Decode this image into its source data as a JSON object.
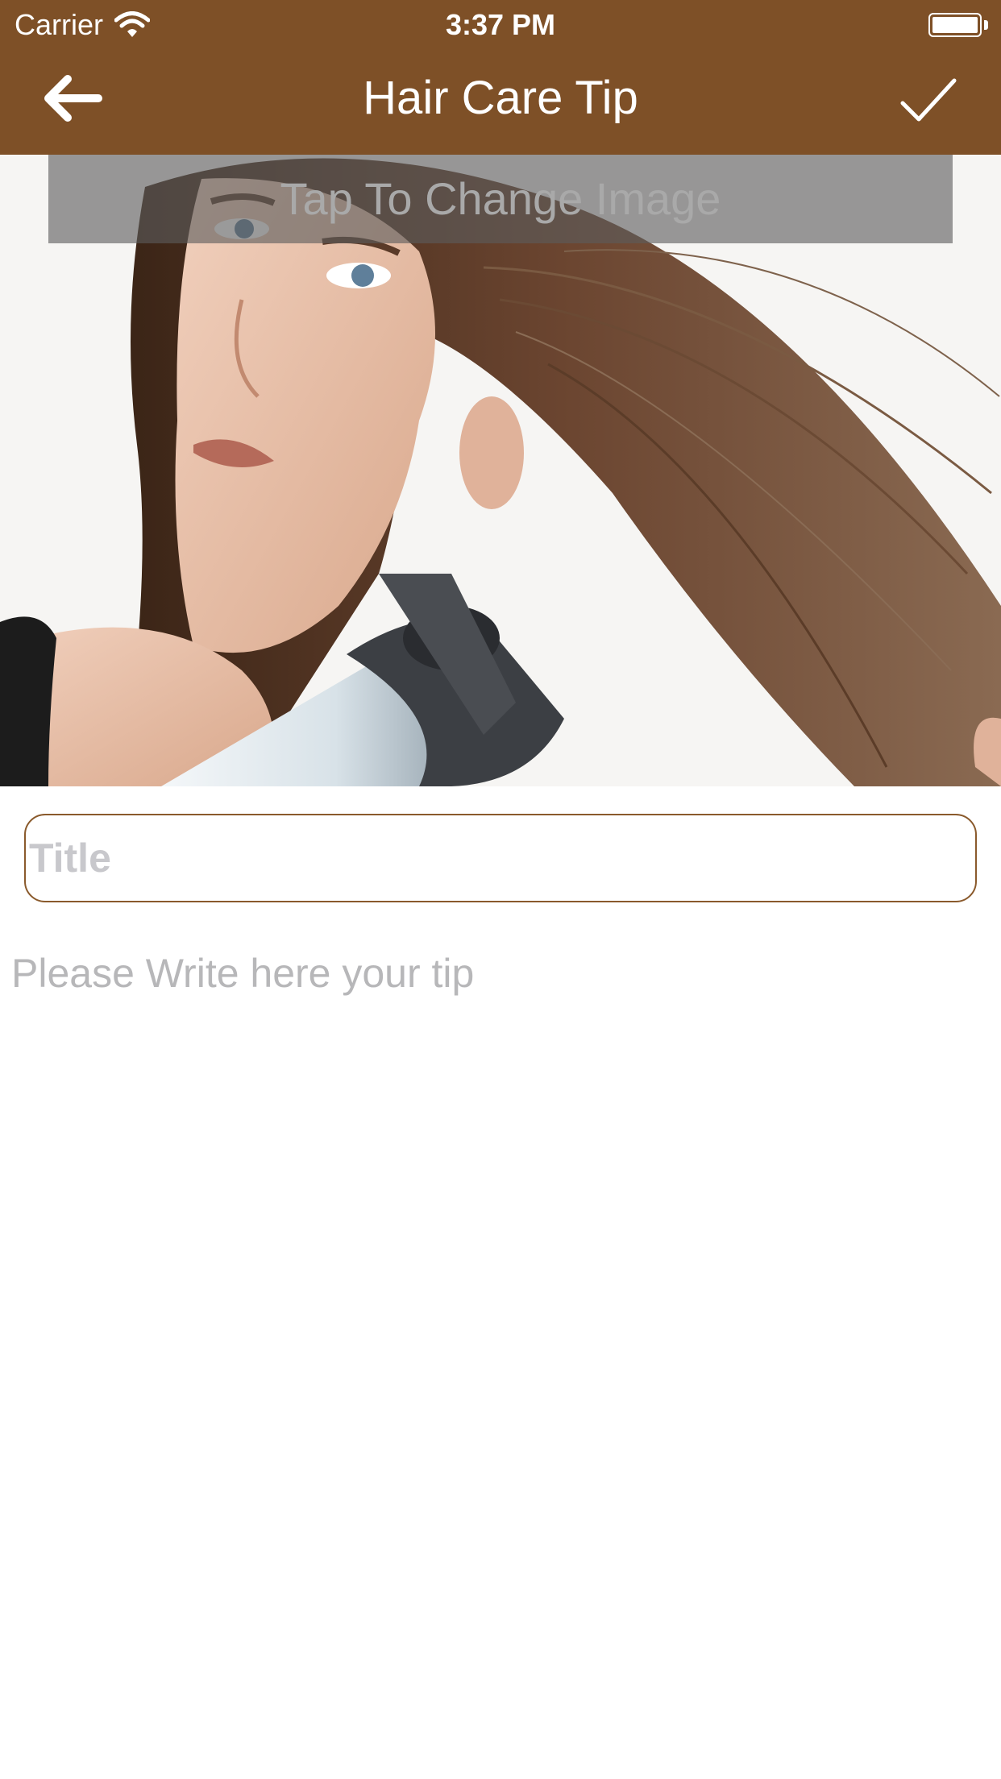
{
  "status_bar": {
    "carrier": "Carrier",
    "time": "3:37 PM",
    "wifi_icon": "wifi-icon",
    "battery_icon": "battery-icon",
    "battery_level": 1.0
  },
  "nav_bar": {
    "title": "Hair Care Tip",
    "back_icon": "arrow-left-icon",
    "done_icon": "checkmark-icon",
    "background_color": "#7e5027"
  },
  "photo": {
    "subject": "woman-blow-drying-hair",
    "change_image_label": "Tap To Change Image"
  },
  "form": {
    "title_placeholder": "Title",
    "title_value": "",
    "tip_placeholder": "Please Write here your tip",
    "tip_value": "",
    "border_color": "#8a5a2c"
  }
}
